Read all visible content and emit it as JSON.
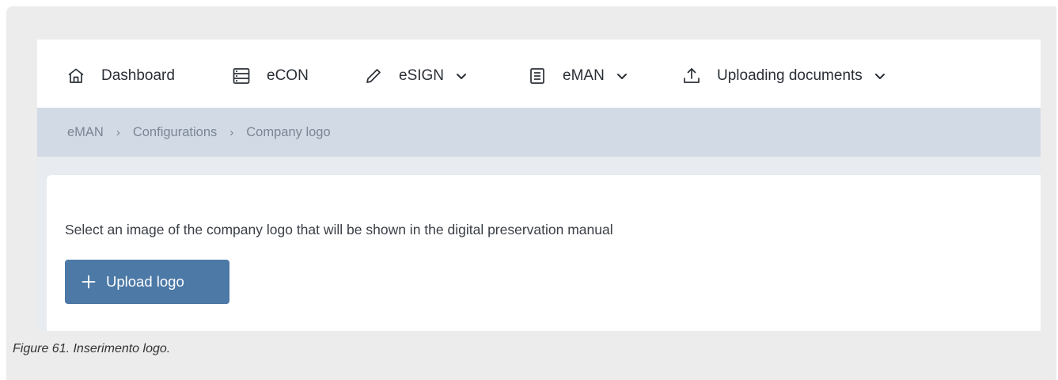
{
  "navbar": {
    "items": [
      {
        "label": "Dashboard",
        "icon": "home-icon",
        "has_dropdown": false
      },
      {
        "label": "eCON",
        "icon": "server-icon",
        "has_dropdown": false
      },
      {
        "label": "eSIGN",
        "icon": "pen-icon",
        "has_dropdown": true
      },
      {
        "label": "eMAN",
        "icon": "document-icon",
        "has_dropdown": true
      },
      {
        "label": "Uploading documents",
        "icon": "upload-icon",
        "has_dropdown": true
      }
    ]
  },
  "breadcrumb": {
    "items": [
      "eMAN",
      "Configurations",
      "Company logo"
    ],
    "separator": "›"
  },
  "panel": {
    "description": "Select an image of the company logo that will be shown in the digital preservation manual",
    "upload_button": {
      "label": "Upload logo",
      "icon": "plus-icon"
    }
  },
  "caption": "Figure 61. Inserimento logo.",
  "colors": {
    "breadcrumb_bg": "#d2dae5",
    "button_bg": "#4c79a6",
    "page_bg": "#e8ebef",
    "frame_bg": "#ececec"
  }
}
